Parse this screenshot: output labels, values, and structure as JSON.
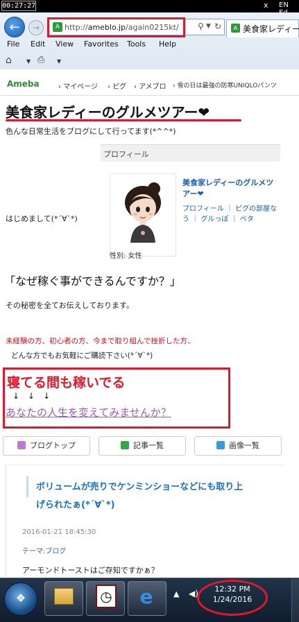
{
  "top_bar": {
    "timer": "00:27:27",
    "close_glyph": "x",
    "language": "EN Ed"
  },
  "browser": {
    "url_prefix": "http://",
    "url_domain": "ameblo.jp",
    "url_path": "/again0215kt/",
    "tab_title": "美食家レディー",
    "favicon_letter": "A",
    "menu": [
      "File",
      "Edit",
      "View",
      "Favorites",
      "Tools",
      "Help"
    ]
  },
  "ameba_header": {
    "logo": "Ameba",
    "nav": [
      "マイページ",
      "ピグ",
      "アメブロ",
      "雪の日は最強の防寒UNIQLOパンツ"
    ]
  },
  "blog": {
    "title": "美食家レディーのグルメツアー❤",
    "subtitle": "色んな日常生活をブログにして行ってます(*^^*)",
    "profile_label": "プロフィール",
    "profile_name": "美食家レディーのグルメツアー❤",
    "profile_links": "プロフィール ｜ ピグの部屋なう ｜ グルっぽ ｜ ペタ",
    "gender": "性別: 女性",
    "greeting": "はじめまして(*´∀`*)"
  },
  "main": {
    "question": "「なぜ稼ぐ事ができるんですか？」",
    "secret": "その秘密を全てお伝えしております。",
    "red_line": "未経験の方、初心者の方、今まで取り組んで挫折した方、",
    "anyone": "どんな方でもお気軽にご購読下さい(*´∀`*)",
    "earn": "寝てる間も稼いでる",
    "arrows": "↓↓↓",
    "change_life": "あなたの人生を変えてみませんか？"
  },
  "buttons": [
    {
      "label": "ブログトップ",
      "color": "#c07ad0"
    },
    {
      "label": "記事一覧",
      "color": "#3aa64a"
    },
    {
      "label": "画像一覧",
      "color": "#3a9ad8"
    }
  ],
  "article": {
    "title": "ボリュームが売りでケンミンショーなどにも取り上げられたぁ(*´∀`*)",
    "date": "2016-01-21 18:45:30",
    "theme_label": "テーマ:",
    "theme_value": "ブログ",
    "body": "アーモンドトーストはご存知ですかぁ？"
  },
  "taskbar": {
    "time": "12:32 PM",
    "date": "1/24/2016",
    "tray_arrow": "▲",
    "volume_glyph": "◀)"
  },
  "colors": {
    "highlight_red": "#e0182d",
    "link_blue": "#1a5fb4",
    "ameba_green": "#2f8a3a"
  }
}
